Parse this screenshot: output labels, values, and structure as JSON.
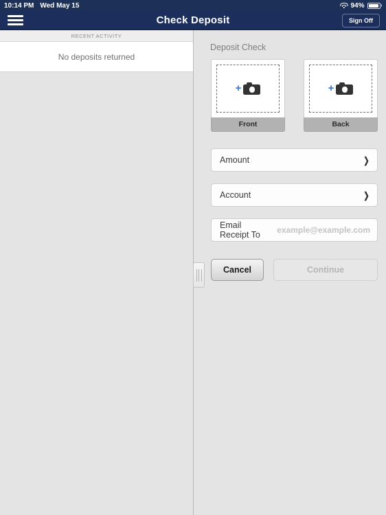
{
  "status_bar": {
    "time": "10:14 PM",
    "date": "Wed May 15",
    "battery_percent": "94%",
    "wifi_icon": "wifi-icon",
    "battery_icon": "battery-icon"
  },
  "nav_bar": {
    "menu_icon": "hamburger-menu-icon",
    "title": "Check Deposit",
    "sign_off_label": "Sign Off"
  },
  "sidebar": {
    "section_header": "RECENT ACTIVITY",
    "empty_message": "No deposits returned"
  },
  "main": {
    "section_title": "Deposit Check",
    "capture_cards": [
      {
        "label": "Front",
        "icon": "camera-icon",
        "add_glyph": "+"
      },
      {
        "label": "Back",
        "icon": "camera-icon",
        "add_glyph": "+"
      }
    ],
    "fields": [
      {
        "label": "Amount",
        "chevron": "❯"
      },
      {
        "label": "Account",
        "chevron": "❯"
      }
    ],
    "email_field": {
      "label": "Email Receipt To",
      "value": "",
      "placeholder": "example@example.com"
    },
    "buttons": {
      "cancel_label": "Cancel",
      "continue_label": "Continue"
    }
  },
  "colors": {
    "navy": "#1c2f5c",
    "status_navy": "#1d3058",
    "pane_gray": "#e4e4e4",
    "accent_blue": "#3b73d4",
    "card_label_gray": "#b2b2b2"
  }
}
